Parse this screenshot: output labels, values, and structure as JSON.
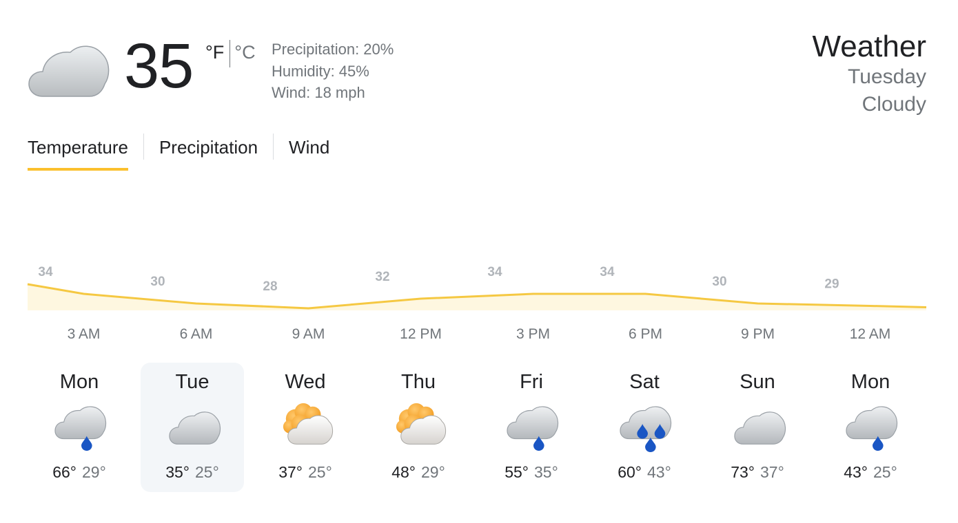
{
  "current": {
    "temperature": "35",
    "unit_f": "°F",
    "unit_c": "°C",
    "icon": "cloudy",
    "precipitation": "Precipitation: 20%",
    "humidity": "Humidity: 45%",
    "wind": "Wind: 18 mph"
  },
  "header": {
    "title": "Weather",
    "day": "Tuesday",
    "condition": "Cloudy"
  },
  "tabs": [
    {
      "label": "Temperature",
      "active": true
    },
    {
      "label": "Precipitation",
      "active": false
    },
    {
      "label": "Wind",
      "active": false
    }
  ],
  "chart_data": {
    "type": "area",
    "x": [
      "3 AM",
      "6 AM",
      "9 AM",
      "12 PM",
      "3 PM",
      "6 PM",
      "9 PM",
      "12 AM"
    ],
    "values": [
      34,
      30,
      28,
      32,
      34,
      34,
      30,
      29
    ],
    "unit": "°F",
    "line_color": "#f5c842",
    "fill_color": "#fef7e0"
  },
  "forecast": [
    {
      "day": "Mon",
      "high": "66°",
      "low": "29°",
      "icon": "rain",
      "selected": false
    },
    {
      "day": "Tue",
      "high": "35°",
      "low": "25°",
      "icon": "cloudy",
      "selected": true
    },
    {
      "day": "Wed",
      "high": "37°",
      "low": "25°",
      "icon": "partly-cloudy",
      "selected": false
    },
    {
      "day": "Thu",
      "high": "48°",
      "low": "29°",
      "icon": "partly-cloudy",
      "selected": false
    },
    {
      "day": "Fri",
      "high": "55°",
      "low": "35°",
      "icon": "rain",
      "selected": false
    },
    {
      "day": "Sat",
      "high": "60°",
      "low": "43°",
      "icon": "heavy-rain",
      "selected": false
    },
    {
      "day": "Sun",
      "high": "73°",
      "low": "37°",
      "icon": "cloudy",
      "selected": false
    },
    {
      "day": "Mon",
      "high": "43°",
      "low": "25°",
      "icon": "rain",
      "selected": false
    }
  ],
  "colors": {
    "accent": "#fbc02d",
    "rain_drop": "#1a56c4",
    "sun": "#f29b1f",
    "selected_day_bg": "#f3f6f9"
  }
}
